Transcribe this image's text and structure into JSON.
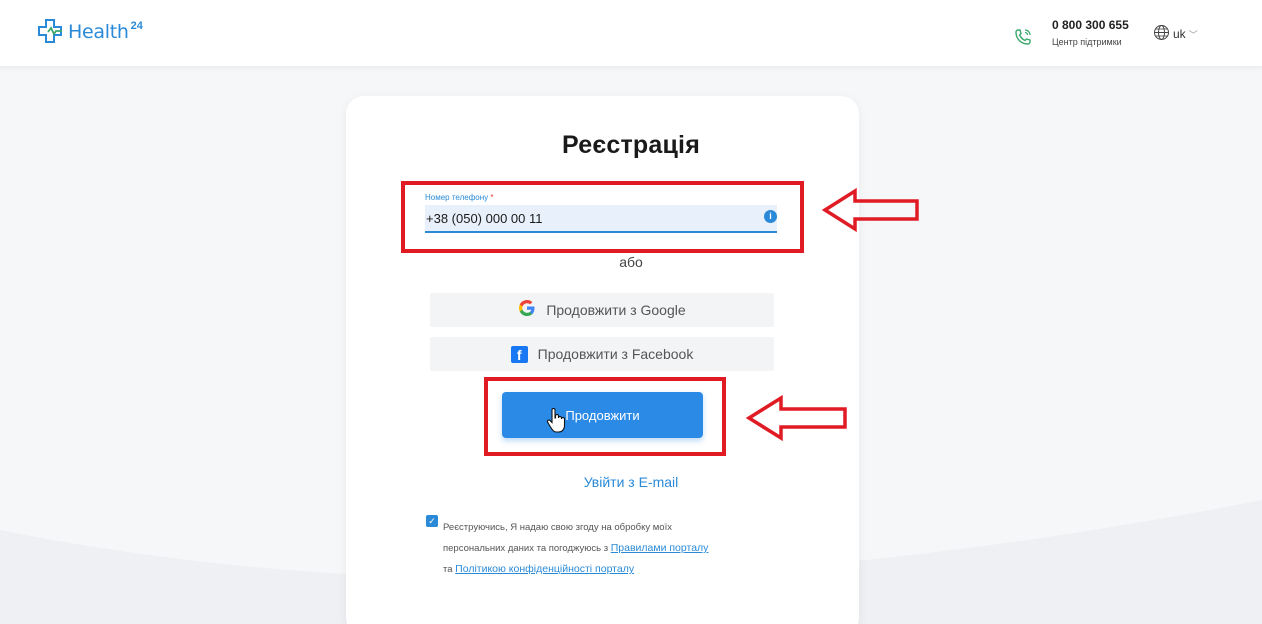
{
  "header": {
    "logo_text": "Health",
    "logo_superscript": "24",
    "support_phone": "0 800 300 655",
    "support_label": "Центр підтримки",
    "language": "uk"
  },
  "form": {
    "title": "Реєстрація",
    "phone_label": "Номер телефону",
    "phone_required_mark": "*",
    "phone_value": "+38 (050) 000 00 11",
    "or_text": "або",
    "google_button": "Продовжити з Google",
    "facebook_button": "Продовжити з Facebook",
    "continue_button": "Продовжити",
    "email_login_link": "Увійти з E-mail",
    "consent_checked": true,
    "consent_text_1": "Реєструючись, Я надаю свою згоду на обробку моїх",
    "consent_text_2": "персональних даних та погоджуюсь з",
    "consent_link_rules": "Правилами порталу",
    "consent_text_3": "та",
    "consent_link_privacy": "Політикою конфіденційності порталу"
  },
  "icons": {
    "logo": "medical-cross-logo-icon",
    "phone": "phone-call-icon",
    "globe": "globe-icon",
    "chevron": "chevron-down-icon",
    "info": "info-icon",
    "google": "google-icon",
    "facebook": "facebook-icon",
    "cursor": "hand-cursor-icon",
    "checkbox": "checkmark-icon"
  },
  "colors": {
    "brand_blue": "#2a8ad8",
    "button_blue": "#2b8ae6",
    "annotation_red": "#e01b24",
    "phone_icon_green": "#3aa86b"
  }
}
